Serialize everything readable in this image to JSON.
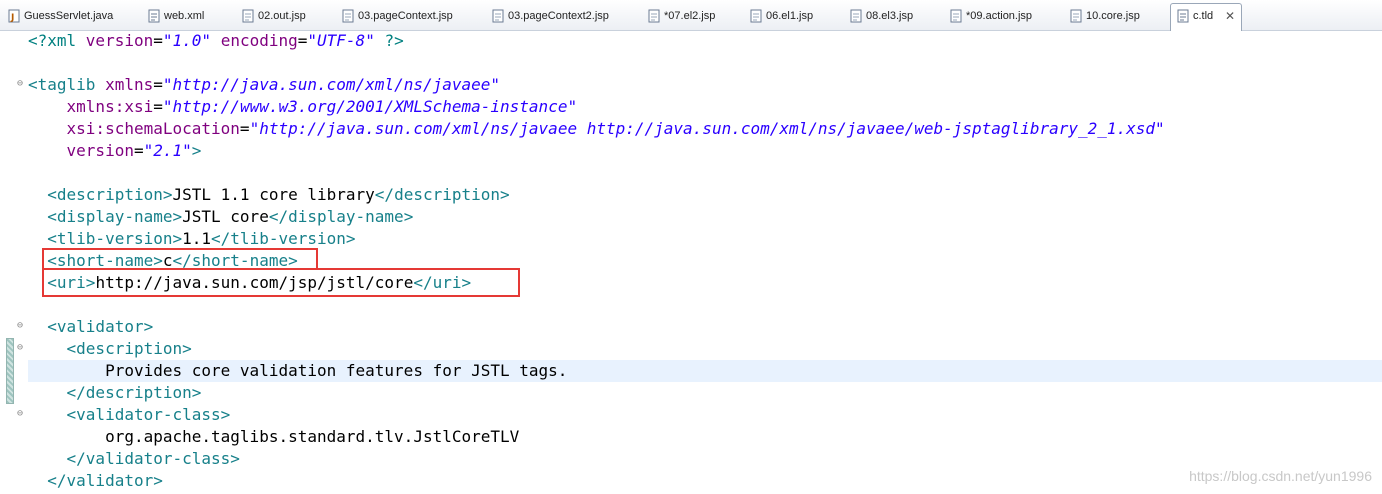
{
  "tabs": [
    {
      "label": "GuessServlet.java",
      "icon": "java-file-icon"
    },
    {
      "label": "web.xml",
      "icon": "xml-file-icon"
    },
    {
      "label": "02.out.jsp",
      "icon": "jsp-file-icon"
    },
    {
      "label": "03.pageContext.jsp",
      "icon": "jsp-file-icon"
    },
    {
      "label": "03.pageContext2.jsp",
      "icon": "jsp-file-icon"
    },
    {
      "label": "*07.el2.jsp",
      "icon": "jsp-file-icon"
    },
    {
      "label": "06.el1.jsp",
      "icon": "jsp-file-icon"
    },
    {
      "label": "08.el3.jsp",
      "icon": "jsp-file-icon"
    },
    {
      "label": "*09.action.jsp",
      "icon": "jsp-file-icon"
    },
    {
      "label": "10.core.jsp",
      "icon": "jsp-file-icon"
    },
    {
      "label": "c.tld",
      "icon": "tld-file-icon",
      "active": true
    }
  ],
  "code": {
    "xml_decl": {
      "open": "<?xml ",
      "a1": "version",
      "v1": "\"1.0\"",
      "a2": "encoding",
      "v2": "\"UTF-8\"",
      "close": " ?>"
    },
    "taglib": {
      "open": "<taglib ",
      "xmlns_attr": "xmlns",
      "xmlns_val": "\"http://java.sun.com/xml/ns/javaee\"",
      "xsi_attr": "xmlns:xsi",
      "xsi_val": "\"http://www.w3.org/2001/XMLSchema-instance\"",
      "loc_attr": "xsi:schemaLocation",
      "loc_val": "\"http://java.sun.com/xml/ns/javaee http://java.sun.com/xml/ns/javaee/web-jsptaglibrary_2_1.xsd\"",
      "ver_attr": "version",
      "ver_val": "\"2.1\"",
      "close": ">"
    },
    "description": {
      "open": "<description>",
      "text": "JSTL 1.1 core library",
      "close": "</description>"
    },
    "display_name": {
      "open": "<display-name>",
      "text": "JSTL core",
      "close": "</display-name>"
    },
    "tlib_version": {
      "open": "<tlib-version>",
      "text": "1.1",
      "close": "</tlib-version>"
    },
    "short_name": {
      "open": "<short-name>",
      "text": "c",
      "close": "</short-name>"
    },
    "uri": {
      "open": "<uri>",
      "text": "http://java.sun.com/jsp/jstl/core",
      "close": "</uri>"
    },
    "validator_open": "<validator>",
    "v_desc_open": "<description>",
    "v_desc_text": "Provides core validation features for JSTL tags.",
    "v_desc_close": "</description>",
    "v_class_open": "<validator-class>",
    "v_class_text": "org.apache.taglibs.standard.tlv.JstlCoreTLV",
    "v_class_close": "</validator-class>",
    "validator_close": "</validator>"
  },
  "watermark": "https://blog.csdn.net/yun1996",
  "colors": {
    "tag": "#17808a",
    "attr": "#7f007f",
    "value": "#2a00ff",
    "highlight_box": "#e53935",
    "current_line": "#e8f2fe"
  }
}
